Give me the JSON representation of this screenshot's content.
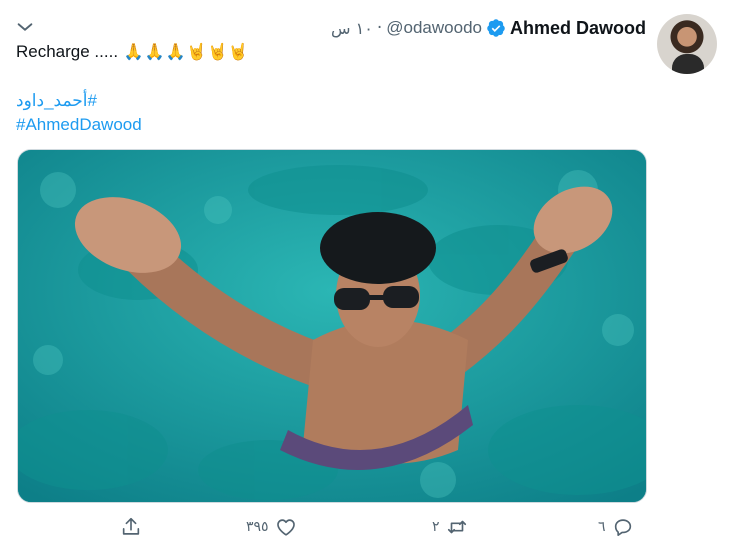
{
  "tweet": {
    "author": {
      "display_name": "Ahmed Dawood",
      "handle": "@odawoodo",
      "verified": true
    },
    "time": "١٠ س",
    "text": "Recharge .....",
    "emojis": [
      "folded-hands",
      "folded-hands",
      "folded-hands",
      "sign-of-the-horns",
      "sign-of-the-horns",
      "sign-of-the-horns"
    ],
    "hashtags": [
      "#أحمد_داود",
      "#AhmedDawood"
    ],
    "media": {
      "kind": "photo"
    },
    "actions": {
      "reply_count": "٦",
      "retweet_count": "٢",
      "like_count": "٣٩٥",
      "share_icon": "share-icon"
    }
  },
  "colors": {
    "accent": "#1d9bf0",
    "text": "#0f1419",
    "secondary": "#536471",
    "water": "#169aa0"
  }
}
